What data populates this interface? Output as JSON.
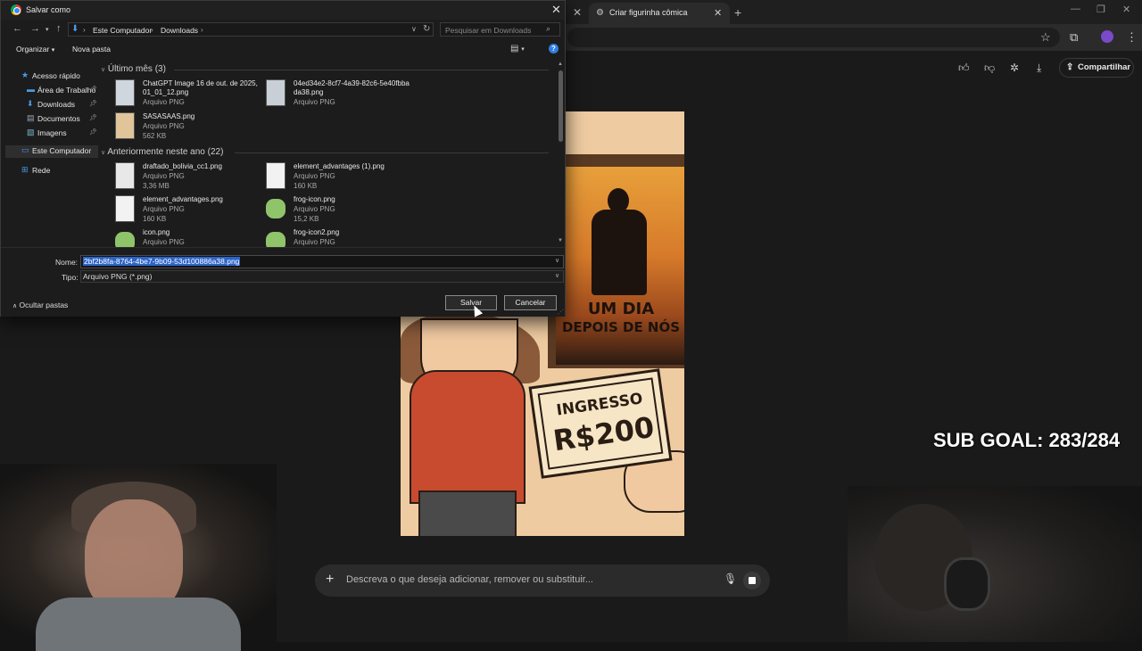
{
  "browser": {
    "tab_title": "Criar figurinha cômica",
    "tab_close": "✕",
    "inactive_tab_close": "✕",
    "new_tab": "+"
  },
  "chat": {
    "share_label": "Compartilhar",
    "prompt_placeholder": "Descreva o que deseja adicionar, remover ou substituir..."
  },
  "comic": {
    "poster_title_line1": "UM DIA",
    "poster_title_line2": "DEPOIS DE NÓS",
    "ticket_label": "INGRESSO",
    "ticket_price": "R$200"
  },
  "overlay": {
    "sub_goal": "SUB GOAL: 283/284"
  },
  "dialog": {
    "title": "Salvar como",
    "path": [
      "Este Computador",
      "Downloads"
    ],
    "search_placeholder": "Pesquisar em Downloads",
    "organize": "Organizar",
    "new_folder": "Nova pasta",
    "help": "?",
    "nav_items": [
      {
        "label": "Acesso rápido",
        "icon": "star-icon",
        "pinned": false
      },
      {
        "label": "Área de Trabalho",
        "icon": "desktop-icon",
        "pinned": true
      },
      {
        "label": "Downloads",
        "icon": "download-icon",
        "pinned": true
      },
      {
        "label": "Documentos",
        "icon": "document-icon",
        "pinned": true
      },
      {
        "label": "Imagens",
        "icon": "image-icon",
        "pinned": true
      },
      {
        "label": "Este Computador",
        "icon": "computer-icon",
        "pinned": false
      },
      {
        "label": "Rede",
        "icon": "network-icon",
        "pinned": false
      }
    ],
    "groups": [
      {
        "header": "Último mês (3)",
        "files": [
          {
            "name1": "ChatGPT Image 16 de out. de 2025,",
            "name2": "01_01_12.png",
            "type": "Arquivo PNG",
            "size": ""
          },
          {
            "name1": "04ed34e2-8cf7-4a39-82c6-5e40fbba",
            "name2": "da38.png",
            "type": "Arquivo PNG",
            "size": ""
          },
          {
            "name1": "SASASAAS.png",
            "name2": "",
            "type": "Arquivo PNG",
            "size": "562 KB"
          }
        ]
      },
      {
        "header": "Anteriormente neste ano (22)",
        "files": [
          {
            "name1": "draftado_bolivia_cc1.png",
            "name2": "",
            "type": "Arquivo PNG",
            "size": "3,36 MB"
          },
          {
            "name1": "element_advantages (1).png",
            "name2": "",
            "type": "Arquivo PNG",
            "size": "160 KB"
          },
          {
            "name1": "element_advantages.png",
            "name2": "",
            "type": "Arquivo PNG",
            "size": "160 KB"
          },
          {
            "name1": "frog-icon.png",
            "name2": "",
            "type": "Arquivo PNG",
            "size": "15,2 KB"
          },
          {
            "name1": "icon.png",
            "name2": "",
            "type": "Arquivo PNG",
            "size": ""
          },
          {
            "name1": "frog-icon2.png",
            "name2": "",
            "type": "Arquivo PNG",
            "size": ""
          }
        ]
      }
    ],
    "name_label": "Nome:",
    "name_value": "2bf2b8fa-8764-4be7-9b09-53d100886a38.png",
    "type_label": "Tipo:",
    "type_value": "Arquivo PNG (*.png)",
    "hide_folders": "Ocultar pastas",
    "save": "Salvar",
    "cancel": "Cancelar"
  },
  "colors": {
    "accent": "#2f7de1",
    "selection": "#2c64c8",
    "background": "#1a1a1a"
  }
}
